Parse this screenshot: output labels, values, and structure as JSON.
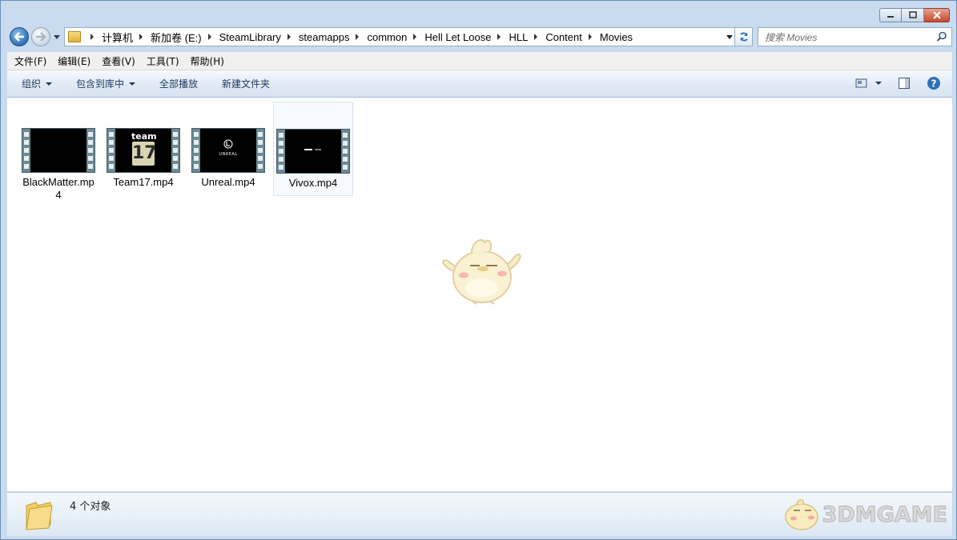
{
  "window": {
    "caption": {
      "minimize_glyph": "—",
      "maximize_glyph": "□",
      "close_glyph": "✕"
    }
  },
  "nav": {
    "breadcrumbs": [
      "计算机",
      "新加卷 (E:)",
      "SteamLibrary",
      "steamapps",
      "common",
      "Hell Let Loose",
      "HLL",
      "Content",
      "Movies"
    ],
    "search_placeholder": "搜索 Movies"
  },
  "menubar": {
    "items": [
      "文件(F)",
      "编辑(E)",
      "查看(V)",
      "工具(T)",
      "帮助(H)"
    ]
  },
  "commandbar": {
    "organize": "组织",
    "include_in_library": "包含到库中",
    "play_all": "全部播放",
    "new_folder": "新建文件夹"
  },
  "files": [
    {
      "name": "BlackMatter.mp4",
      "thumb": "black"
    },
    {
      "name": "Team17.mp4",
      "thumb": "team17",
      "thumb_text": [
        "team",
        "17"
      ]
    },
    {
      "name": "Unreal.mp4",
      "thumb": "unreal",
      "thumb_text": [
        "UNREAL"
      ]
    },
    {
      "name": "Vivox.mp4",
      "thumb": "vivox",
      "selected": true
    }
  ],
  "status": {
    "count_text": "4 个对象"
  },
  "watermark": {
    "brand": "3DMGAME"
  },
  "colors": {
    "accent": "#1e395b",
    "selection_bg": "#f6f9fd",
    "window_frame": "#c9dcef"
  }
}
